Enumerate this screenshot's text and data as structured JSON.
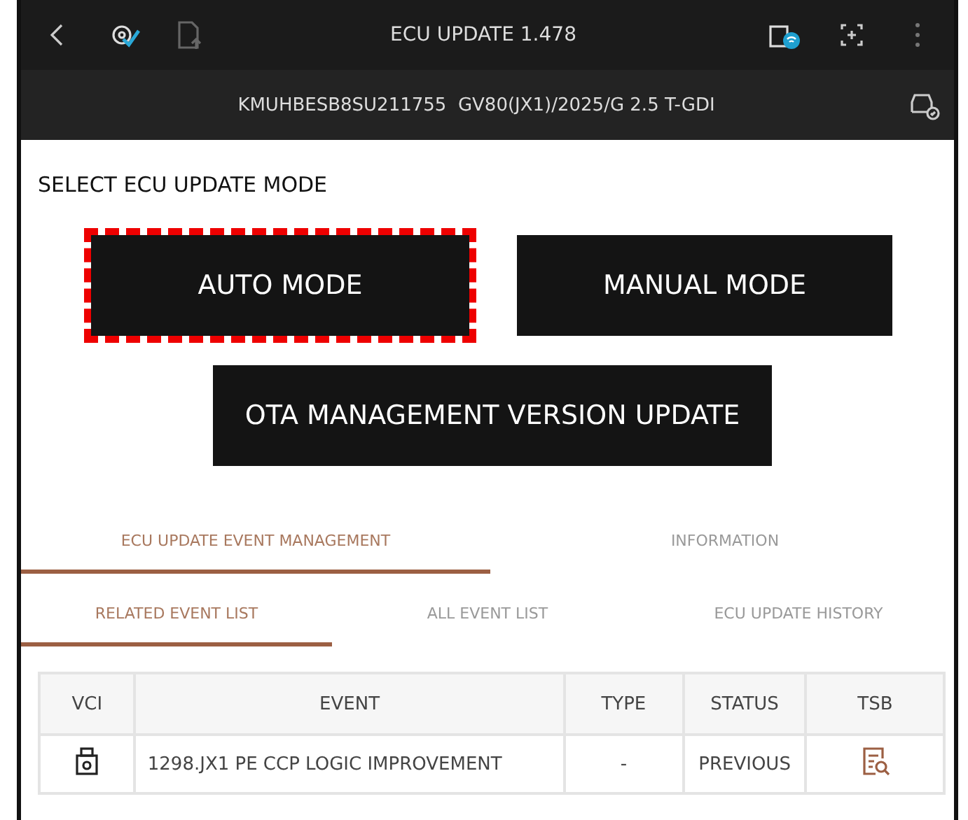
{
  "header": {
    "title": "ECU UPDATE 1.478",
    "vehicle": "KMUHBESB8SU211755  GV80(JX1)/2025/G 2.5 T-GDI"
  },
  "section_title": "SELECT ECU UPDATE MODE",
  "mode_buttons": [
    {
      "label": "AUTO MODE",
      "highlighted": true
    },
    {
      "label": "MANUAL MODE",
      "highlighted": false
    },
    {
      "label": "OTA MANAGEMENT VERSION UPDATE",
      "highlighted": false
    }
  ],
  "tabs": [
    {
      "label": "ECU UPDATE EVENT MANAGEMENT",
      "selected": true
    },
    {
      "label": "INFORMATION",
      "selected": false
    }
  ],
  "subtabs": [
    {
      "label": "RELATED EVENT LIST",
      "selected": true
    },
    {
      "label": "ALL EVENT LIST",
      "selected": false
    },
    {
      "label": "ECU UPDATE HISTORY",
      "selected": false
    }
  ],
  "table": {
    "columns": [
      "VCI",
      "EVENT",
      "TYPE",
      "STATUS",
      "TSB"
    ],
    "rows": [
      {
        "event": "1298.JX1 PE CCP LOGIC IMPROVEMENT",
        "type": "-",
        "status": "PREVIOUS"
      }
    ]
  }
}
